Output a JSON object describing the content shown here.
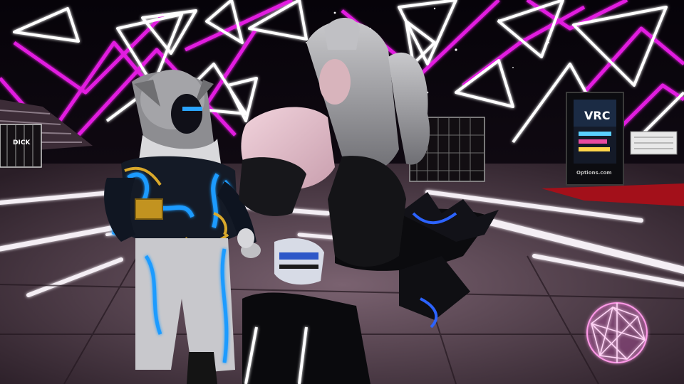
{
  "scene": {
    "type": "vr-social-world-screenshot",
    "setting": "neon club room with glowing triangle wall patterns and checkered floor",
    "colors": {
      "neon_magenta": "#e21ee0",
      "neon_white": "#ffffff",
      "sky": "#050308",
      "floor_dark": "#3a2a36",
      "floor_light": "#6c5563",
      "accent_blue": "#1e9bff",
      "accent_gold": "#d9a82b",
      "carpet_red": "#b0101a",
      "hair_grey": "#a9a9ad",
      "sweater_pink": "#e8c3cf"
    },
    "signs": {
      "left_wall_text": "DICK",
      "kiosk_screen_text": "VRC",
      "kiosk_footer_text": "Options.com"
    },
    "objects": [
      "left-avatar-hooded-blue-neon",
      "center-avatar-grey-twin-tails-pink-sweater",
      "right-avatar-black-spiky-hair",
      "info-kiosk",
      "wire-gem-sphere",
      "side-staircase"
    ]
  }
}
